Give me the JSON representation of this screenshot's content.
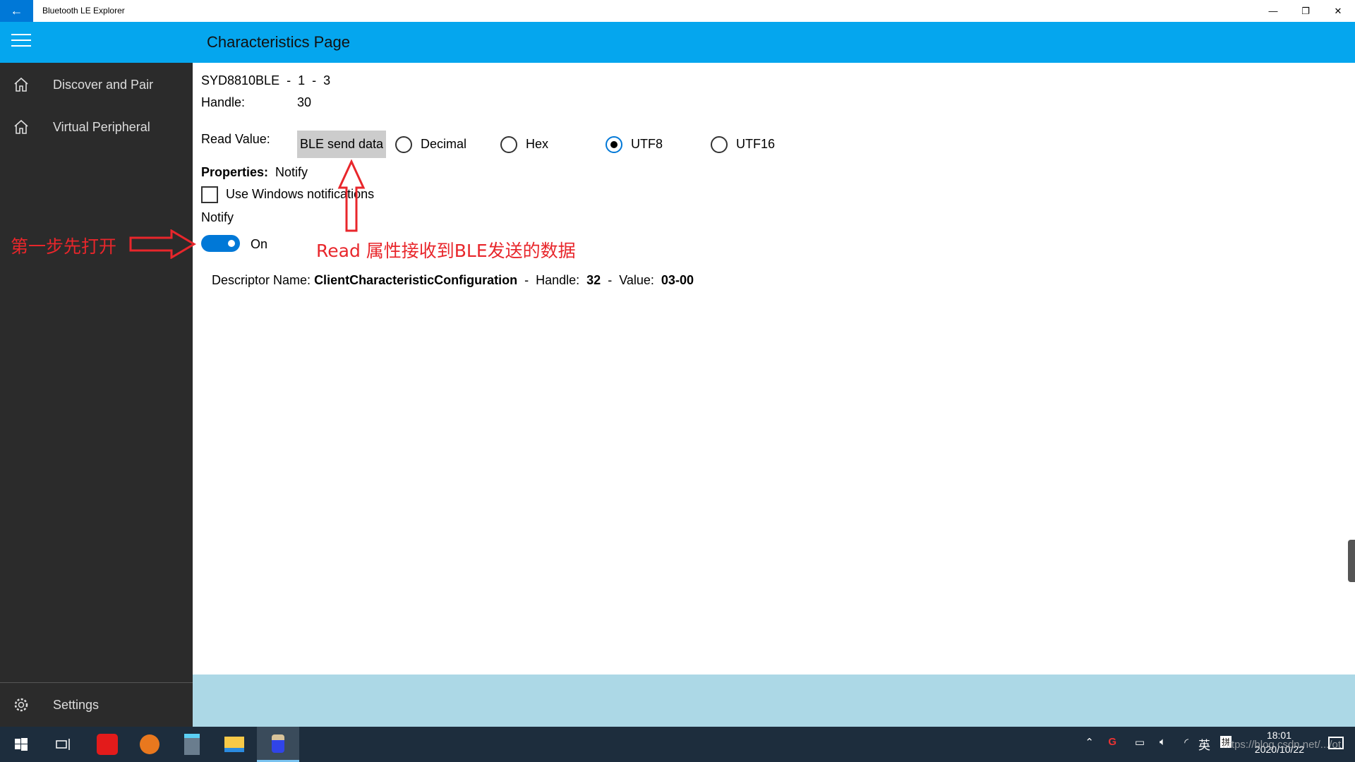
{
  "window": {
    "title": "Bluetooth LE Explorer",
    "back": "←",
    "minimize": "—",
    "restore": "❐",
    "close": "✕"
  },
  "header": {
    "title": "Characteristics Page"
  },
  "sidebar": {
    "items": [
      {
        "label": "Discover and Pair",
        "icon": "home-icon"
      },
      {
        "label": "Virtual Peripheral",
        "icon": "home-icon"
      }
    ],
    "settings": "Settings"
  },
  "main": {
    "device": "SYD8810BLE",
    "sep": "-",
    "service_index": "1",
    "char_index": "3",
    "handle_label": "Handle:",
    "handle_value": "30",
    "read_label": "Read Value:",
    "read_button": "BLE send data",
    "formats": [
      {
        "label": "Decimal",
        "selected": false
      },
      {
        "label": "Hex",
        "selected": false
      },
      {
        "label": "UTF8",
        "selected": true
      },
      {
        "label": "UTF16",
        "selected": false
      }
    ],
    "properties_label": "Properties:",
    "properties_value": "Notify",
    "use_windows_notifications": "Use Windows notifications",
    "notify_label": "Notify",
    "toggle_state": "On",
    "descriptor": {
      "name_label": "Descriptor Name:",
      "name": "ClientCharacteristicConfiguration",
      "handle_label": "Handle:",
      "handle": "32",
      "value_label": "Value:",
      "value": "03-00"
    }
  },
  "annotations": {
    "step1": "第一步先打开",
    "read_note": "Read 属性接收到BLE发送的数据",
    "color": "#e8262b"
  },
  "taskbar": {
    "time": "18:01",
    "date": "2020/10/22",
    "ime": "英",
    "ime2": "拼",
    "watermark": "https://blog.csdn.net/.../ot"
  }
}
